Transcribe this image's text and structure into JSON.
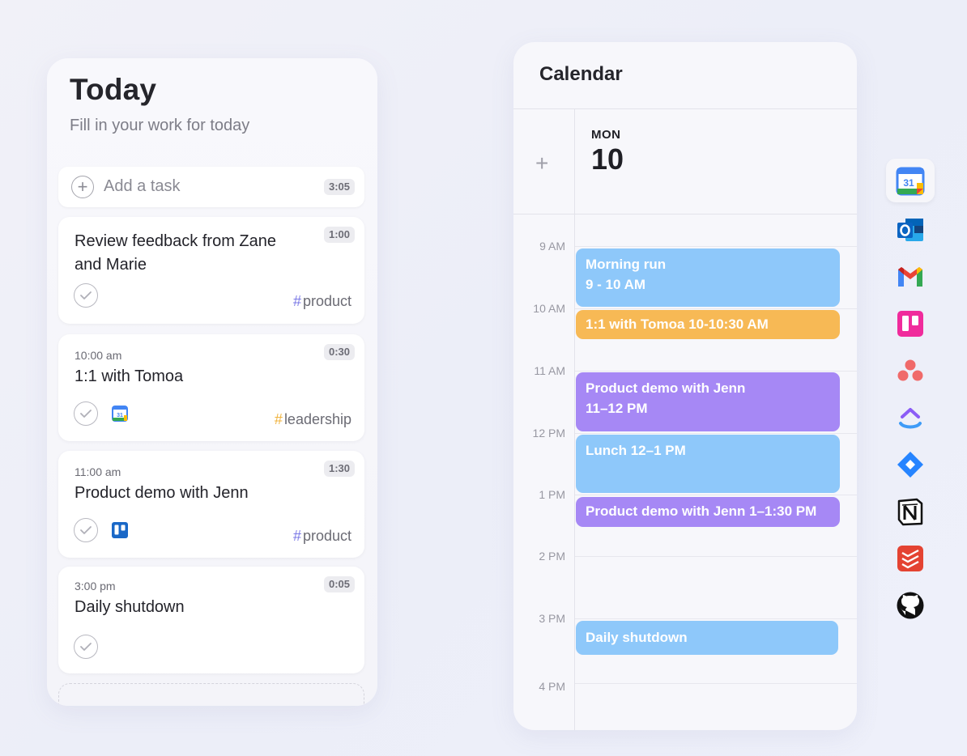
{
  "today": {
    "title": "Today",
    "subtitle": "Fill in your work for today",
    "add_task": {
      "label": "Add a task",
      "total_time": "3:05"
    },
    "tasks": [
      {
        "time": "",
        "title_line1": "Review feedback from Zane",
        "title_line2": "and Marie",
        "duration": "1:00",
        "tag": "product",
        "tag_color": "#7a78e6",
        "source": ""
      },
      {
        "time": "10:00 am",
        "title_line1": "1:1 with Tomoa",
        "title_line2": "",
        "duration": "0:30",
        "tag": "leadership",
        "tag_color": "#f0b33e",
        "source": "google-calendar-icon"
      },
      {
        "time": "11:00 am",
        "title_line1": "Product demo with Jenn",
        "title_line2": "",
        "duration": "1:30",
        "tag": "product",
        "tag_color": "#7a78e6",
        "source": "trello-icon"
      },
      {
        "time": "3:00 pm",
        "title_line1": "Daily shutdown",
        "title_line2": "",
        "duration": "0:05",
        "tag": "",
        "tag_color": "",
        "source": ""
      }
    ]
  },
  "calendar": {
    "title": "Calendar",
    "add_symbol": "+",
    "day_name": "MON",
    "day_number": "10",
    "hours": [
      "9 AM",
      "10 AM",
      "11 AM",
      "12 PM",
      "1 PM",
      "2 PM",
      "3 PM",
      "4 PM"
    ],
    "events": [
      {
        "line1": "Morning run",
        "line2": "9 - 10 AM",
        "color": "#8ec8fa"
      },
      {
        "line1": "1:1 with Tomoa 10-10:30 AM",
        "line2": "",
        "color": "#f7b955"
      },
      {
        "line1": "Product demo with Jenn",
        "line2": "11–12 PM",
        "color": "#a688f5"
      },
      {
        "line1": "Lunch 12–1 PM",
        "line2": "",
        "color": "#8ec8fa"
      },
      {
        "line1": "Product demo with Jenn 1–1:30 PM",
        "line2": "",
        "color": "#a688f5"
      },
      {
        "line1": "Daily shutdown",
        "line2": "",
        "color": "#8ec8fa"
      }
    ]
  },
  "integrations": {
    "google_calendar_number": "31",
    "items": [
      "google-calendar-icon",
      "outlook-icon",
      "gmail-icon",
      "trello-icon",
      "asana-icon",
      "clickup-icon",
      "jira-icon",
      "notion-icon",
      "todoist-icon",
      "github-icon"
    ],
    "active": "google-calendar-icon"
  }
}
